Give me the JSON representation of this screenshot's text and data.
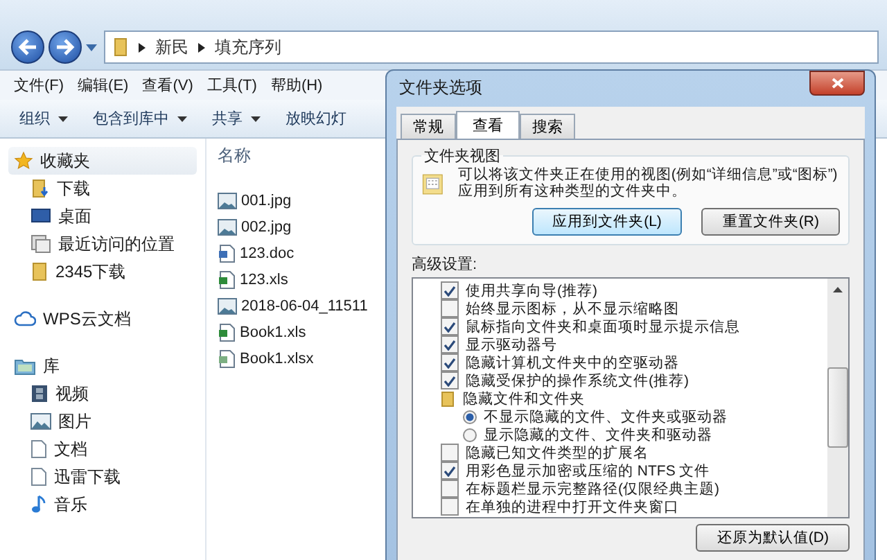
{
  "explorer": {
    "breadcrumb": [
      "新民",
      "填充序列"
    ],
    "menu": [
      "文件(F)",
      "编辑(E)",
      "查看(V)",
      "工具(T)",
      "帮助(H)"
    ],
    "toolbar": [
      {
        "label": "组织",
        "dropdown": true
      },
      {
        "label": "包含到库中",
        "dropdown": true
      },
      {
        "label": "共享",
        "dropdown": true
      },
      {
        "label": "放映幻灯",
        "dropdown": false
      }
    ],
    "sidebar": [
      {
        "label": "收藏夹",
        "kind": "star",
        "selected": true,
        "children": [
          {
            "label": "下载",
            "kind": "download"
          },
          {
            "label": "桌面",
            "kind": "desktop"
          },
          {
            "label": "最近访问的位置",
            "kind": "recent"
          },
          {
            "label": "2345下载",
            "kind": "folder"
          }
        ]
      },
      {
        "label": "WPS云文档",
        "kind": "cloud",
        "selected": false
      },
      {
        "label": "库",
        "kind": "library",
        "selected": false,
        "children": [
          {
            "label": "视频",
            "kind": "video"
          },
          {
            "label": "图片",
            "kind": "image"
          },
          {
            "label": "文档",
            "kind": "doc"
          },
          {
            "label": "迅雷下载",
            "kind": "download2"
          },
          {
            "label": "音乐",
            "kind": "music"
          }
        ]
      }
    ],
    "column": "名称",
    "files": [
      {
        "name": "001.jpg",
        "kind": "image"
      },
      {
        "name": "002.jpg",
        "kind": "image"
      },
      {
        "name": "123.doc",
        "kind": "doc"
      },
      {
        "name": "123.xls",
        "kind": "xls"
      },
      {
        "name": "2018-06-04_11511",
        "kind": "image"
      },
      {
        "name": "Book1.xls",
        "kind": "xls"
      },
      {
        "name": "Book1.xlsx",
        "kind": "xlsx"
      }
    ]
  },
  "dialog": {
    "title": "文件夹选项",
    "tabs": [
      {
        "label": "常规",
        "selected": false
      },
      {
        "label": "查看",
        "selected": true
      },
      {
        "label": "搜索",
        "selected": false
      }
    ],
    "folder_views": {
      "title": "文件夹视图",
      "description": "可以将该文件夹正在使用的视图(例如“详细信息”或“图标”)应用到所有这种类型的文件夹中。",
      "buttons": [
        "应用到文件夹(L)",
        "重置文件夹(R)"
      ]
    },
    "advanced_label": "高级设置:",
    "settings": [
      {
        "kind": "checkbox",
        "label": "使用共享向导(推荐)",
        "checked": true
      },
      {
        "kind": "checkbox",
        "label": "始终显示图标，从不显示缩略图",
        "checked": false
      },
      {
        "kind": "checkbox",
        "label": "鼠标指向文件夹和桌面项时显示提示信息",
        "checked": true
      },
      {
        "kind": "checkbox",
        "label": "显示驱动器号",
        "checked": true
      },
      {
        "kind": "checkbox",
        "label": "隐藏计算机文件夹中的空驱动器",
        "checked": true
      },
      {
        "kind": "checkbox",
        "label": "隐藏受保护的操作系统文件(推荐)",
        "checked": true
      },
      {
        "kind": "folder",
        "label": "隐藏文件和文件夹",
        "children": [
          {
            "kind": "radio",
            "label": "不显示隐藏的文件、文件夹或驱动器",
            "checked": true
          },
          {
            "kind": "radio",
            "label": "显示隐藏的文件、文件夹和驱动器",
            "checked": false
          }
        ]
      },
      {
        "kind": "checkbox",
        "label": "隐藏已知文件类型的扩展名",
        "checked": false
      },
      {
        "kind": "checkbox",
        "label": "用彩色显示加密或压缩的 NTFS 文件",
        "checked": true
      },
      {
        "kind": "checkbox",
        "label": "在标题栏显示完整路径(仅限经典主题)",
        "checked": false
      },
      {
        "kind": "checkbox",
        "label": "在单独的进程中打开文件夹窗口",
        "checked": false
      }
    ],
    "restore_button": "还原为默认值(D)"
  }
}
